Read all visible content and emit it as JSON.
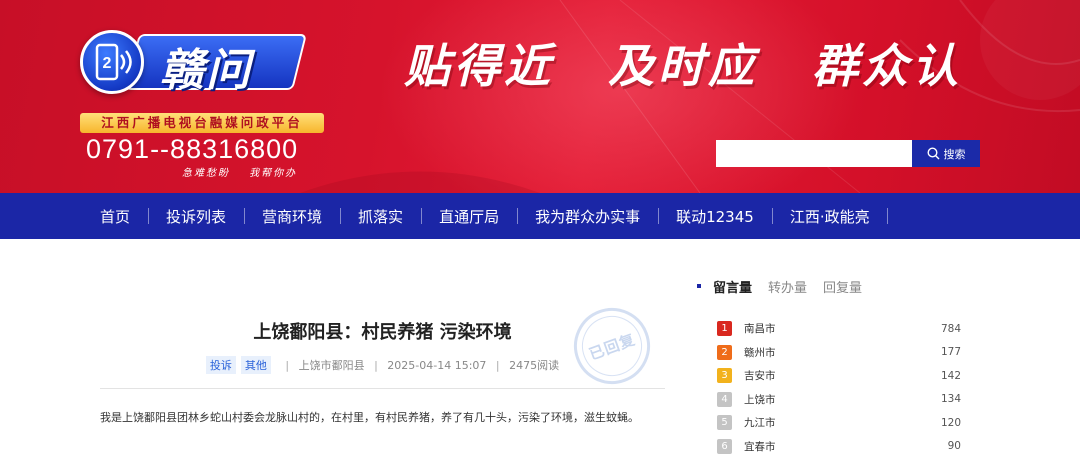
{
  "brand": {
    "logo_text": "赣问",
    "logo_badge": "2",
    "subtitle": "江西广播电视台融媒问政平台",
    "hotline": "0791--88316800",
    "hotline_sub": [
      "急难愁盼",
      "我帮你办"
    ],
    "slogan": [
      "贴得近",
      "及时应",
      "群众认"
    ]
  },
  "search": {
    "placeholder": "",
    "button_label": "搜索"
  },
  "nav": {
    "items": [
      "首页",
      "投诉列表",
      "营商环境",
      "抓落实",
      "直通厅局",
      "我为群众办实事",
      "联动12345",
      "江西·政能亮"
    ]
  },
  "article": {
    "title": "上饶鄱阳县：村民养猪 污染环境",
    "tags": [
      "投诉",
      "其他"
    ],
    "location": "上饶市鄱阳县",
    "datetime": "2025-04-14 15:07",
    "reads": "2475阅读",
    "stamp": "已回复",
    "body": "我是上饶鄱阳县团林乡蛇山村委会龙脉山村的，在村里，有村民养猪，养了有几十头，污染了环境，滋生蚊蝇。"
  },
  "sidebar": {
    "tabs": [
      "留言量",
      "转办量",
      "回复量"
    ],
    "active_tab": 0,
    "ranking": [
      {
        "rank": "1",
        "city": "南昌市",
        "value": "784",
        "color": "#d9281f"
      },
      {
        "rank": "2",
        "city": "赣州市",
        "value": "177",
        "color": "#ef6c1a"
      },
      {
        "rank": "3",
        "city": "吉安市",
        "value": "142",
        "color": "#f2b21d"
      },
      {
        "rank": "4",
        "city": "上饶市",
        "value": "134",
        "color": "#c4c4c4"
      },
      {
        "rank": "5",
        "city": "九江市",
        "value": "120",
        "color": "#c4c4c4"
      },
      {
        "rank": "6",
        "city": "宜春市",
        "value": "90",
        "color": "#c4c4c4"
      }
    ]
  }
}
